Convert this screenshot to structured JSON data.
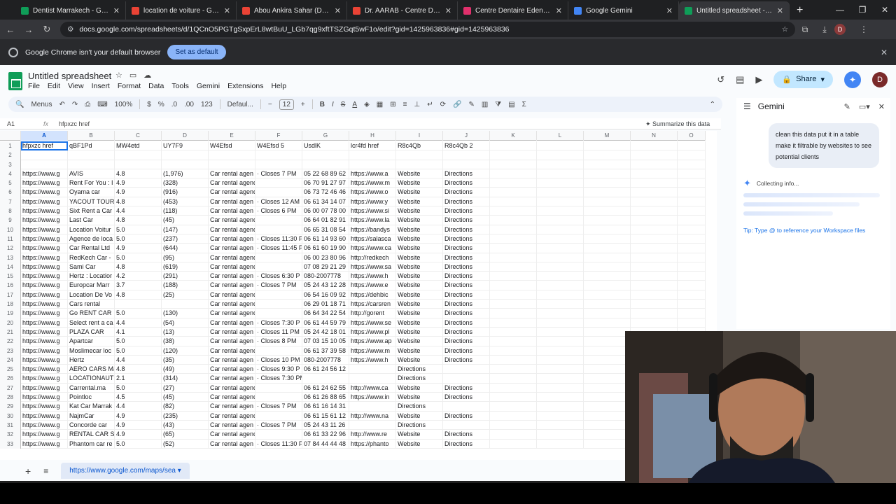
{
  "browser": {
    "tabs": [
      {
        "title": "Dentist Marrakech - Google Sh",
        "color": "#0f9d58"
      },
      {
        "title": "location de voiture - Google M",
        "color": "#ea4335"
      },
      {
        "title": "Abou Ankira Sahar (Dentiste) -",
        "color": "#ea4335"
      },
      {
        "title": "Dr. AARAB - Centre Dentaire Et",
        "color": "#ea4335"
      },
      {
        "title": "Centre Dentaire Eden (@centre",
        "color": "#e1306c"
      },
      {
        "title": "Google Gemini",
        "color": "#4285f4"
      },
      {
        "title": "Untitled spreadsheet - Google",
        "color": "#0f9d58"
      }
    ],
    "url": "docs.google.com/spreadsheets/d/1QCnO5PGTgSxpErL8wtBuU_LGb7qg9xftTSZGqt5wF1o/edit?gid=1425963836#gid=1425963836",
    "profile_initial": "D",
    "infobar_text": "Google Chrome isn't your default browser",
    "infobar_button": "Set as default"
  },
  "sheets": {
    "title": "Untitled spreadsheet",
    "menu": [
      "File",
      "Edit",
      "View",
      "Insert",
      "Format",
      "Data",
      "Tools",
      "Gemini",
      "Extensions",
      "Help"
    ],
    "share_label": "Share",
    "user_initial": "D",
    "toolbar": {
      "menus": "Menus",
      "zoom": "100%",
      "currency": "$",
      "percent": "%",
      "dec_down": ".0",
      "dec_up": ".00",
      "numfmt": "123",
      "font": "Defaul...",
      "font_size": "12"
    },
    "name_box": "A1",
    "formula": "hfpxzc href",
    "summarize": "Summarize this data",
    "columns": [
      "A",
      "B",
      "C",
      "D",
      "E",
      "F",
      "G",
      "H",
      "I",
      "J",
      "K",
      "L",
      "M",
      "N",
      "O"
    ],
    "rows": [
      [
        "hfpxzc href",
        "qBF1Pd",
        "MW4etd",
        "UY7F9",
        "W4Efsd",
        "W4Efsd 5",
        "UsdlK",
        "lcr4fd href",
        "R8c4Qb",
        "R8c4Qb 2"
      ],
      [
        "",
        "",
        "",
        "",
        "",
        "",
        "",
        "",
        "",
        ""
      ],
      [
        "",
        "",
        "",
        "",
        "",
        "",
        "",
        "",
        "",
        ""
      ],
      [
        "https://www.g",
        "AVIS",
        "4.8",
        "(1,976)",
        "Car rental agen",
        "· Closes 7 PM",
        "05 22 68 89 62",
        "https://www.a",
        "Website",
        "Directions"
      ],
      [
        "https://www.g",
        "Rent For You : I",
        "4.9",
        "(328)",
        "Car rental agency",
        "",
        "06 70 91 27 97",
        "https://www.m",
        "Website",
        "Directions"
      ],
      [
        "https://www.g",
        "Oyama car",
        "4.9",
        "(916)",
        "Car rental agency",
        "",
        "06 73 72 46 46",
        "https://www.o",
        "Website",
        "Directions"
      ],
      [
        "https://www.g",
        "YACOUT TOURS",
        "4.8",
        "(453)",
        "Car rental agen",
        "· Closes 12 AM",
        "06 61 34 14 07",
        "https://www.y",
        "Website",
        "Directions"
      ],
      [
        "https://www.g",
        "Sixt Rent a Car",
        "4.4",
        "(118)",
        "Car rental agen",
        "· Closes 6 PM",
        "06 00 07 78 00",
        "https://www.si",
        "Website",
        "Directions"
      ],
      [
        "https://www.g",
        "Last Car",
        "4.8",
        "(45)",
        "Car rental agency",
        "",
        "06 64 01 82 91",
        "https://www.la",
        "Website",
        "Directions"
      ],
      [
        "https://www.g",
        "Location Voitur",
        "5.0",
        "(147)",
        "Car rental agency",
        "",
        "06 65 31 08 54",
        "https://bandys",
        "Website",
        "Directions"
      ],
      [
        "https://www.g",
        "Agence de loca",
        "5.0",
        "(237)",
        "Car rental agen",
        "· Closes 11:30 P",
        "06 61 14 93 60",
        "https://salasca",
        "Website",
        "Directions"
      ],
      [
        "https://www.g",
        "Car Rental Ltd",
        "4.9",
        "(644)",
        "Car rental agen",
        "· Closes 11:45 P",
        "06 61 60 19 90",
        "https://www.ca",
        "Website",
        "Directions"
      ],
      [
        "https://www.g",
        "RedKech Car -",
        "5.0",
        "(95)",
        "Car rental agency",
        "",
        "06 00 23 80 96",
        "http://redkech",
        "Website",
        "Directions"
      ],
      [
        "https://www.g",
        "Sami Car",
        "4.8",
        "(619)",
        "Car rental agency",
        "",
        "07 08 29 21 29",
        "https://www.sa",
        "Website",
        "Directions"
      ],
      [
        "https://www.g",
        "Hertz : Locatior",
        "4.2",
        "(291)",
        "Car rental agen",
        "· Closes 6:30 P",
        "080-2007778",
        "https://www.h",
        "Website",
        "Directions"
      ],
      [
        "https://www.g",
        "Europcar Marr",
        "3.7",
        "(188)",
        "Car rental agen",
        "· Closes 7 PM",
        "05 24 43 12 28",
        "https://www.e",
        "Website",
        "Directions"
      ],
      [
        "https://www.g",
        "Location De Vo",
        "4.8",
        "(25)",
        "Car rental agency",
        "",
        "06 54 16 09 92",
        "https://dehbic",
        "Website",
        "Directions"
      ],
      [
        "https://www.g",
        "Cars rental",
        "",
        "",
        "Car rental agency",
        "",
        "06 29 01 18 71",
        "https://carsren",
        "Website",
        "Directions"
      ],
      [
        "https://www.g",
        "Go RENT CAR",
        "5.0",
        "(130)",
        "Car rental agency",
        "",
        "06 64 34 22 54",
        "http://gorent",
        "Website",
        "Directions"
      ],
      [
        "https://www.g",
        "Select rent a ca",
        "4.4",
        "(54)",
        "Car rental agen",
        "· Closes 7:30 P",
        "06 61 44 59 79",
        "https://www.se",
        "Website",
        "Directions"
      ],
      [
        "https://www.g",
        "PLAZA CAR",
        "4.1",
        "(13)",
        "Car rental agen",
        "· Closes 11 PM",
        "05 24 42 18 01",
        "https://www.pl",
        "Website",
        "Directions"
      ],
      [
        "https://www.g",
        "Apartcar",
        "5.0",
        "(38)",
        "Car rental agen",
        "· Closes 8 PM",
        "07 03 15 10 05",
        "https://www.ap",
        "Website",
        "Directions"
      ],
      [
        "https://www.g",
        "Moslimecar loc",
        "5.0",
        "(120)",
        "Car rental agency",
        "",
        "06 61 37 39 58",
        "https://www.m",
        "Website",
        "Directions"
      ],
      [
        "https://www.g",
        "Hertz",
        "4.4",
        "(35)",
        "Car rental agen",
        "· Closes 10 PM",
        "080-2007778",
        "https://www.h",
        "Website",
        "Directions"
      ],
      [
        "https://www.g",
        "AERO CARS Ma",
        "4.8",
        "(49)",
        "Car rental agen",
        "· Closes 9:30 P",
        "06 61 24 56 12",
        "",
        "Directions",
        ""
      ],
      [
        "https://www.g",
        "LOCATIONAUT",
        "2.1",
        "(314)",
        "Car rental agen",
        "· Closes 7:30 PM",
        "",
        "",
        "Directions",
        ""
      ],
      [
        "https://www.g",
        "Carrental.ma",
        "5.0",
        "(27)",
        "Car rental agency",
        "",
        "06 61 24 62 55",
        "http://www.ca",
        "Website",
        "Directions"
      ],
      [
        "https://www.g",
        "Pointloc",
        "4.5",
        "(45)",
        "Car rental agency",
        "",
        "06 61 26 88 65",
        "https://www.in",
        "Website",
        "Directions"
      ],
      [
        "https://www.g",
        "Kat Car Marrak",
        "4.4",
        "(82)",
        "Car rental agen",
        "· Closes 7 PM",
        "06 61 16 14 31",
        "",
        "Directions",
        ""
      ],
      [
        "https://www.g",
        "NajmCar",
        "4.9",
        "(235)",
        "Car rental agency",
        "",
        "06 61 15 61 12",
        "http://www.na",
        "Website",
        "Directions"
      ],
      [
        "https://www.g",
        "Concorde car",
        "4.9",
        "(43)",
        "Car rental agen",
        "· Closes 7 PM",
        "05 24 43 11 26",
        "",
        "Directions",
        ""
      ],
      [
        "https://www.g",
        "RENTAL CAR ST",
        "4.9",
        "(65)",
        "Car rental agency",
        "",
        "06 61 33 22 96",
        "http://www.re",
        "Website",
        "Directions"
      ],
      [
        "https://www.g",
        "Phantom car re",
        "5.0",
        "(52)",
        "Car rental agen",
        "· Closes 11:30 F",
        "07 84 44 44 48",
        "https://phanto",
        "Website",
        "Directions"
      ]
    ],
    "sheet_tab": "https://www.google.com/maps/sea"
  },
  "gemini": {
    "title": "Gemini",
    "prompt": "clean this data put it in a table make it filtrable by websites to see potential clients",
    "status": "Collecting info...",
    "tip": "Tip: Type @ to reference your Workspace files"
  }
}
